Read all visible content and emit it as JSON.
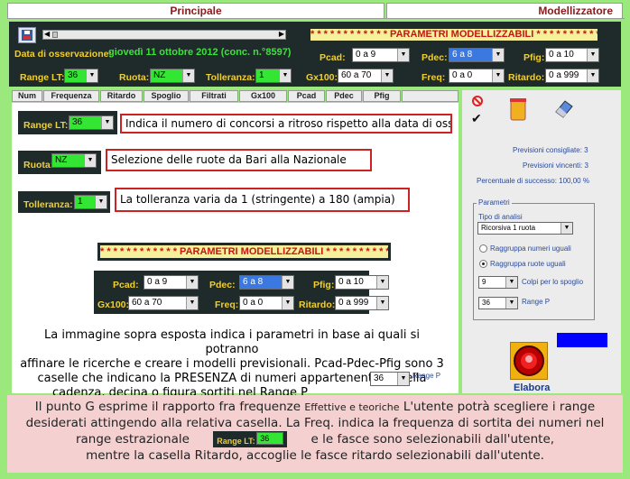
{
  "tabs": {
    "principale": "Principale",
    "modellizzatore": "Modellizzatore"
  },
  "header": {
    "obs_label": "Data di osservazione:",
    "obs_value": "giovedì 11 ottobre 2012 (conc. n.°8597)",
    "banner": "* * * * * * * * * * * * PARAMETRI MODELLIZZABILI * * * * * * * * * * *",
    "range_label": "Range LT:",
    "range_value": "36",
    "ruota_label": "Ruota:",
    "ruota_value": "NZ",
    "toll_label": "Tolleranza:",
    "toll_value": "1",
    "pcad_label": "Pcad:",
    "pcad_value": "0 a 9",
    "pdec_label": "Pdec:",
    "pdec_value": "6 a 8",
    "pfig_label": "Pfig:",
    "pfig_value": "0 a 10",
    "gx_label": "Gx100:",
    "gx_value": "60 a 70",
    "freq_label": "Freq:",
    "freq_value": "0 a 0",
    "rit_label": "Ritardo:",
    "rit_value": "0 a 999"
  },
  "columns": [
    "Num",
    "Frequenza",
    "Ritardo",
    "Spoglio",
    "Filtrati",
    "Gx100",
    "Pcad",
    "Pdec",
    "Pfig"
  ],
  "content": {
    "range_desc": "Indica il numero di concorsi a ritroso rispetto alla data di osservazione",
    "ruota_desc": "Selezione delle ruote da Bari alla Nazionale",
    "toll_desc": "La tolleranza varia da 1 (stringente) a 180 (ampia)",
    "banner": "* * * * * * * * * * * * PARAMETRI MODELLIZZABILI * * * * * * * * * * *",
    "para_lines": [
      "La immagine sopra esposta indica i parametri in base ai quali si potranno",
      "affinare le ricerche e creare i modelli previsionali. Pcad-Pdec-Pfig sono 3",
      "caselle che indicano la PRESENZA di numeri appartenenti a quella",
      "cadenza, decina o figura sortiti nel Range P"
    ],
    "range_p_value": "36",
    "range_p_label": "Range P"
  },
  "right": {
    "prev_consigliate": "Previsioni consigliate: 3",
    "prev_vincenti": "Previsioni vincenti: 3",
    "percentuale": "Percentuale di successo: 100,00 %",
    "parametri": "Parametri",
    "tipo_analisi": "Tipo di analisi",
    "tipo_value": "Ricorsiva 1 ruota",
    "radio1": "Raggruppa numeri uguali",
    "radio2": "Raggruppa ruote uguali",
    "colpi_value": "9",
    "colpi_label": "Colpi per lo spoglio",
    "rangep_value": "36",
    "rangep_label": "Range P",
    "elabora": "Elabora"
  },
  "bottom": {
    "l1a": "Il punto G esprime il rapporto fra frequenze",
    "l1b": "Effettive e teoriche",
    "l1c": "L'utente potrà scegliere i range",
    "l2": "desiderati attingendo alla relativa casella. La Freq. indica la frequenza di sortita dei numeri nel",
    "l3a": "range estrazionale",
    "l3b": "e le fasce sono selezionabili dall'utente,",
    "l4": "mentre la casella Ritardo, accoglie le fasce ritardo selezionabili dall'utente.",
    "inline_range_label": "Range LT:",
    "inline_range_value": "36"
  },
  "colors": {
    "accent_yellow": "#f0d030",
    "accent_green": "#3ee03e",
    "dark": "#1f2a2a",
    "blue_box": "#0000ff"
  }
}
